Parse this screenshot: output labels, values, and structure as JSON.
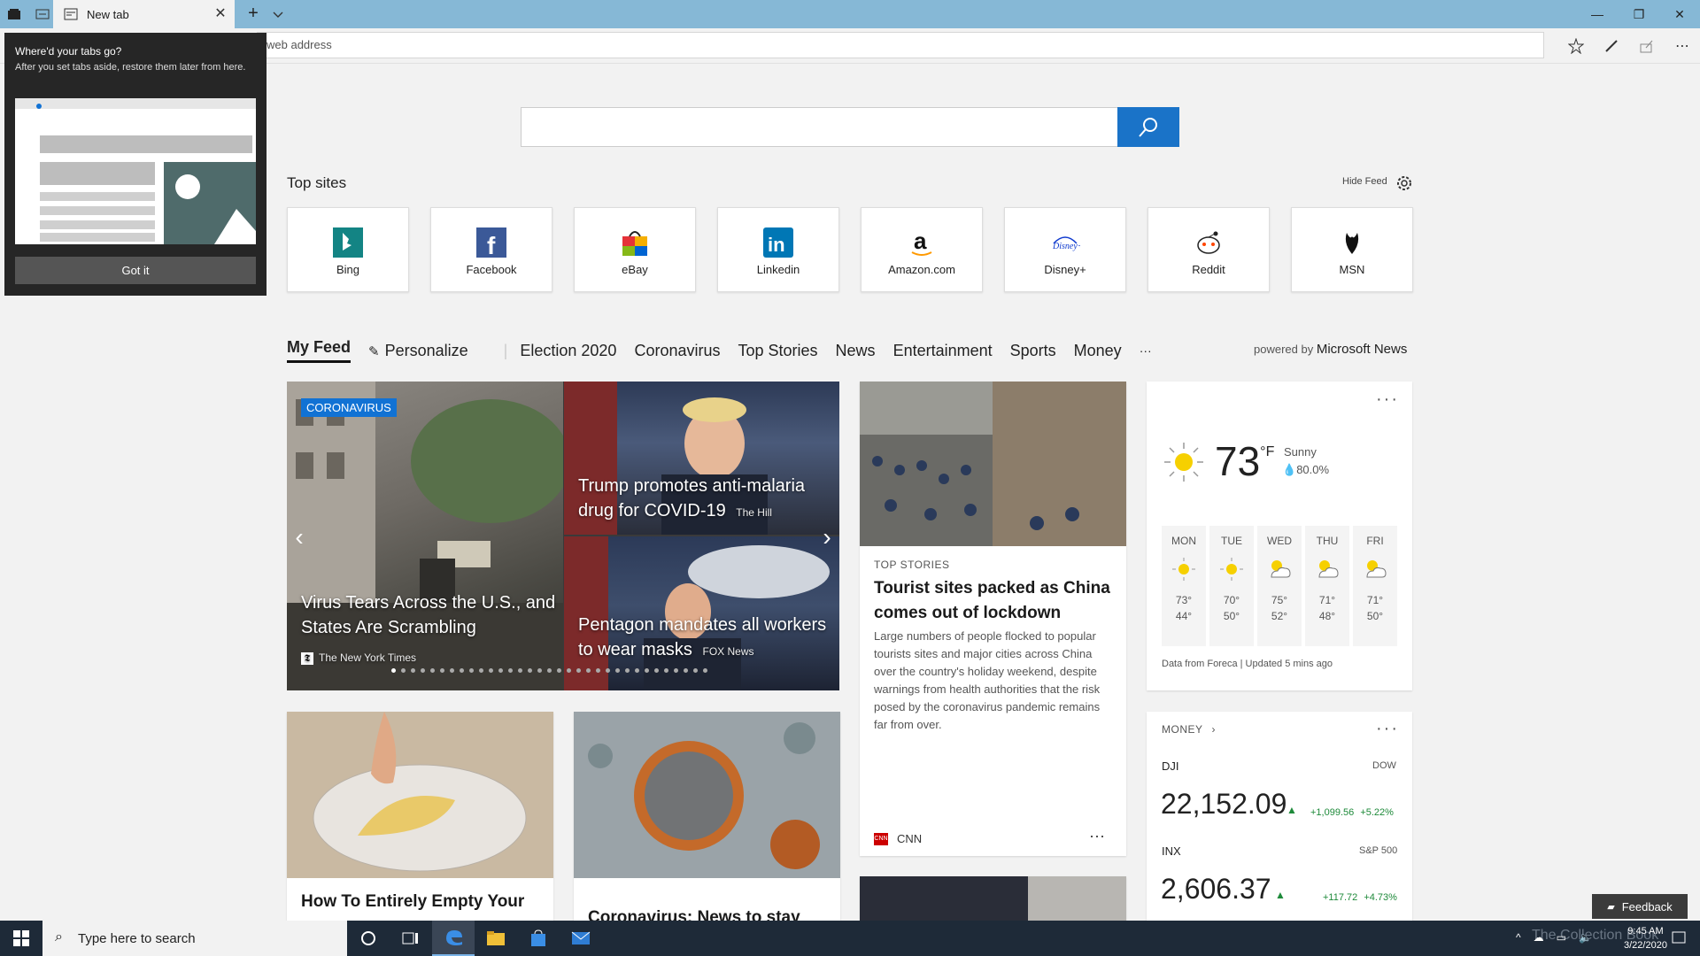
{
  "browser": {
    "tab_title": "New tab",
    "new_tab": "+",
    "address_placeholder": "Search or enter web address",
    "address_visible_text": "web address"
  },
  "popup": {
    "title": "Where'd your tabs go?",
    "body": "After you set tabs aside, restore them later from here.",
    "button": "Got it"
  },
  "top_sites": {
    "title": "Top sites",
    "hide_feed": "Hide Feed",
    "items": [
      {
        "label": "Bing",
        "icon": "bing-icon",
        "color": "#138484"
      },
      {
        "label": "Facebook",
        "icon": "facebook-icon",
        "color": "#3b5998"
      },
      {
        "label": "eBay",
        "icon": "ebay-icon",
        "color": "#e53238"
      },
      {
        "label": "Linkedin",
        "icon": "linkedin-icon",
        "color": "#0077b5"
      },
      {
        "label": "Amazon.com",
        "icon": "amazon-icon",
        "color": "#111111"
      },
      {
        "label": "Disney+",
        "icon": "disney-icon",
        "color": "#113ccf"
      },
      {
        "label": "Reddit",
        "icon": "reddit-icon",
        "color": "#ff4500"
      },
      {
        "label": "MSN",
        "icon": "msn-icon",
        "color": "#111111"
      }
    ]
  },
  "feed_nav": {
    "items": [
      "My Feed",
      "Personalize",
      "Election 2020",
      "Coronavirus",
      "Top Stories",
      "News",
      "Entertainment",
      "Sports",
      "Money"
    ],
    "more": "···",
    "powered_prefix": "powered by",
    "powered_brand": "Microsoft News"
  },
  "carousel": {
    "badge": "CORONAVIRUS",
    "main_headline": "Virus Tears Across the U.S., and States Are Scrambling",
    "main_source": "The New York Times",
    "top_headline": "Trump promotes anti-malaria drug for COVID-19",
    "top_source": "The Hill",
    "bottom_headline": "Pentagon mandates all workers to wear masks",
    "bottom_source": "FOX News"
  },
  "story": {
    "kicker": "TOP STORIES",
    "headline": "Tourist sites packed as China comes out of lockdown",
    "body": "Large numbers of people flocked to popular tourists sites and major cities across China over the country's holiday weekend, despite warnings from health authorities that the risk posed by the coronavirus pandemic remains far from over.",
    "source": "CNN",
    "more": "···"
  },
  "weather": {
    "temp": "73",
    "unit": "°F",
    "condition": "Sunny",
    "precip": "80.0%",
    "more": "···",
    "days": [
      {
        "name": "MON",
        "hi": "73°",
        "lo": "44°",
        "icon": "sun-icon"
      },
      {
        "name": "TUE",
        "hi": "70°",
        "lo": "50°",
        "icon": "sun-icon"
      },
      {
        "name": "WED",
        "hi": "75°",
        "lo": "52°",
        "icon": "partly-cloudy-icon"
      },
      {
        "name": "THU",
        "hi": "71°",
        "lo": "48°",
        "icon": "partly-cloudy-icon"
      },
      {
        "name": "FRI",
        "hi": "71°",
        "lo": "50°",
        "icon": "partly-cloudy-icon"
      }
    ],
    "footer": "Data from Foreca | Updated 5 mins ago"
  },
  "money": {
    "title": "MONEY",
    "more": "···",
    "dji_symbol": "DJI",
    "dji_name": "DOW",
    "dji_value": "22,152.09",
    "dji_change": "+1,099.56",
    "dji_pct": "+5.22%",
    "inx_symbol": "INX",
    "inx_name": "S&P 500",
    "inx_value": "2,606.37",
    "inx_change": "+117.72",
    "inx_pct": "+4.73%",
    "up_color": "#1e8a3a"
  },
  "bottom_cards": {
    "left_headline": "How To Entirely Empty Your",
    "mid_headline": "Coronavirus: News to stay"
  },
  "feedback": "Feedback",
  "taskbar": {
    "search_placeholder": "Type here to search",
    "time": "9:45 AM",
    "date": "3/22/2020",
    "watermark": "The Collection Book"
  }
}
